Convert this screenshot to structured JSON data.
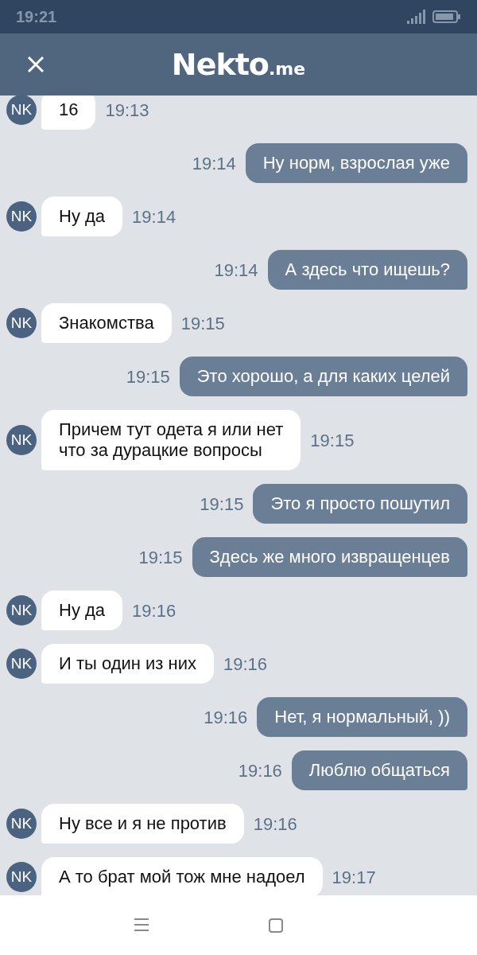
{
  "status_bar": {
    "time": "19:21"
  },
  "header": {
    "logo_main": "Nekto",
    "logo_suffix": ".me"
  },
  "messages": [
    {
      "kind": "incoming",
      "avatar": "NK",
      "text": "16",
      "time": "19:13"
    },
    {
      "kind": "outgoing",
      "text": "Ну норм, взрослая уже",
      "time": "19:14"
    },
    {
      "kind": "incoming",
      "avatar": "NK",
      "text": "Ну да",
      "time": "19:14"
    },
    {
      "kind": "outgoing",
      "text": "А здесь что ищешь?",
      "time": "19:14"
    },
    {
      "kind": "incoming",
      "avatar": "NK",
      "text": "Знакомства",
      "time": "19:15"
    },
    {
      "kind": "outgoing",
      "text": "Это хорошо, а для каких целей",
      "time": "19:15"
    },
    {
      "kind": "incoming",
      "avatar": "NK",
      "text": "Причем тут одета я или нет\nчто за дурацкие вопросы",
      "time": "19:15"
    },
    {
      "kind": "outgoing",
      "text": "Это я просто пошутил",
      "time": "19:15"
    },
    {
      "kind": "outgoing",
      "text": "Здесь же много извращенцев",
      "time": "19:15"
    },
    {
      "kind": "incoming",
      "avatar": "NK",
      "text": "Ну да",
      "time": "19:16"
    },
    {
      "kind": "incoming",
      "avatar": "NK",
      "text": "И ты один из них",
      "time": "19:16"
    },
    {
      "kind": "outgoing",
      "text": "Нет, я нормальный, ))",
      "time": "19:16"
    },
    {
      "kind": "outgoing",
      "text": "Люблю общаться",
      "time": "19:16"
    },
    {
      "kind": "incoming",
      "avatar": "NK",
      "text": "Ну все и я не против",
      "time": "19:16"
    },
    {
      "kind": "incoming",
      "avatar": "NK",
      "text": "А то брат мой тож мне надоел",
      "time": "19:17"
    }
  ]
}
